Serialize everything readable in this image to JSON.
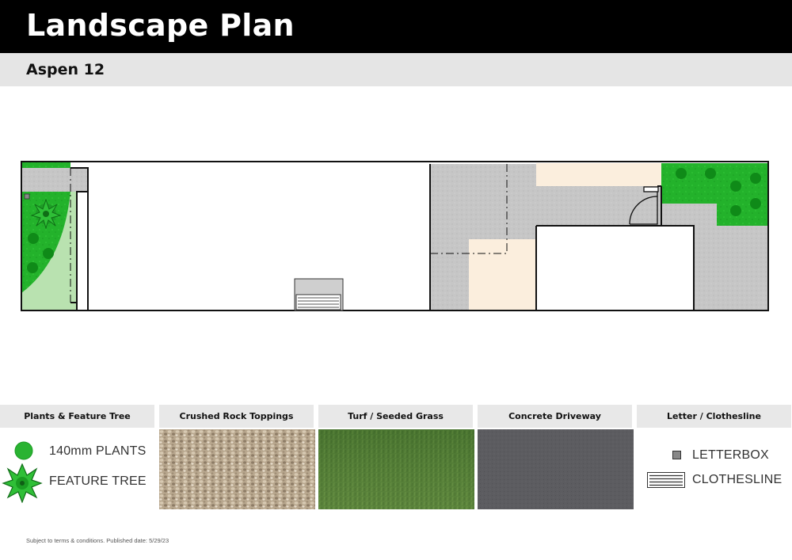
{
  "header": {
    "title": "Landscape Plan",
    "subtitle": "Aspen 12"
  },
  "colors": {
    "header_bg": "#000000",
    "subheader_bg": "#e5e5e5",
    "garden_green": "#24b52c",
    "turf_light_green": "#b9e2b0",
    "crushed_rock_grey": "#c4c4c4",
    "paving_cream": "#fbeedd",
    "outline": "#111111"
  },
  "legend": [
    {
      "heading": "Plants & Feature Tree",
      "items": [
        {
          "icon": "plant-icon",
          "label": "140mm PLANTS"
        },
        {
          "icon": "feature-tree-icon",
          "label": "FEATURE TREE"
        }
      ]
    },
    {
      "heading": "Crushed Rock Toppings",
      "swatch": "crushed-rock-texture"
    },
    {
      "heading": "Turf / Seeded Grass",
      "swatch": "turf-texture"
    },
    {
      "heading": "Concrete Driveway",
      "swatch": "concrete-texture"
    },
    {
      "heading": "Letter / Clothesline",
      "items": [
        {
          "icon": "letterbox-icon",
          "label": "LETTERBOX"
        },
        {
          "icon": "clothesline-icon",
          "label": "CLOTHESLINE"
        }
      ]
    }
  ],
  "footer": {
    "disclaimer": "Subject to terms & conditions. Published date: 5/29/23"
  }
}
